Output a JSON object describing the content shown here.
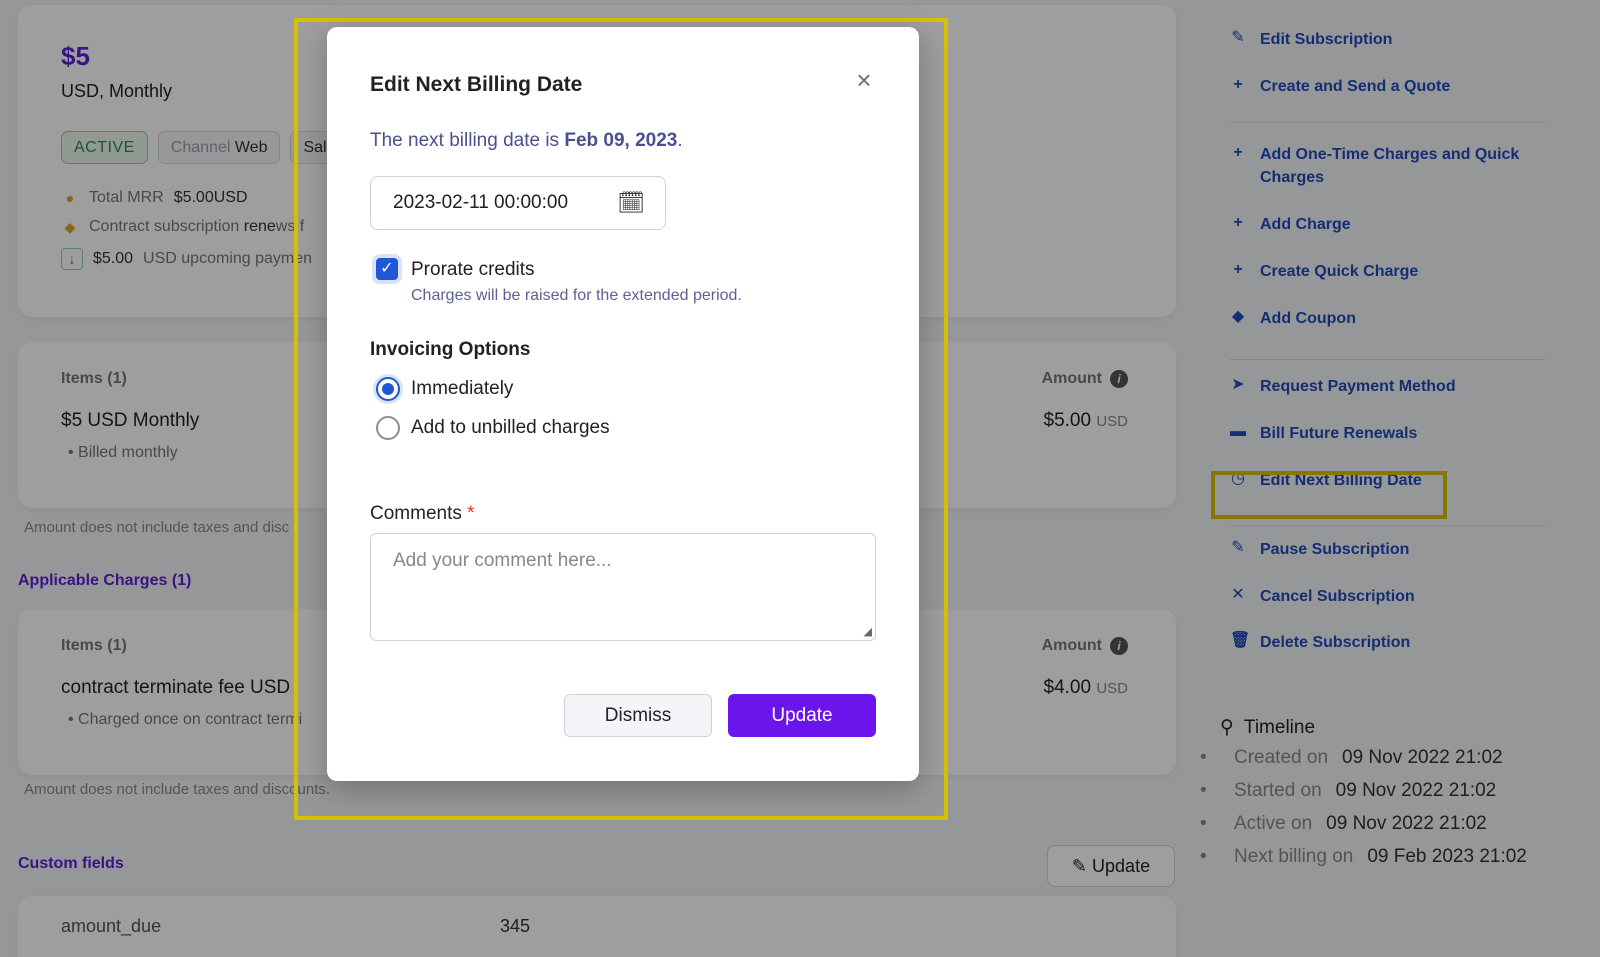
{
  "summary": {
    "price": "$5",
    "price_sub": "USD, Monthly",
    "badge_status": "ACTIVE",
    "badge_channel_label": "Channel",
    "badge_channel_value": "Web",
    "badge_sales_partial": "Sal",
    "total_mrr_label": "Total MRR",
    "total_mrr_value": "$5.00USD",
    "contract_text_a": "Contract subscription",
    "contract_text_b": "rene",
    "contract_text_c": "ws f",
    "upcoming_amount": "$5.00",
    "upcoming_text": "USD upcoming paymen"
  },
  "items": {
    "header": "Items (1)",
    "amount_header": "Amount",
    "name": "$5 USD Monthly",
    "sub": "• Billed monthly",
    "amount": "$5.00",
    "currency": "USD",
    "note": "Amount does not include taxes and disc"
  },
  "charges": {
    "section_title": "Applicable Charges (1)",
    "header": "Items (1)",
    "amount_header": "Amount",
    "name": "contract terminate fee USD",
    "sub": "• Charged once on contract termi",
    "amount": "$4.00",
    "currency": "USD",
    "note": "Amount does not include taxes and discounts."
  },
  "custom_fields": {
    "title": "Custom fields",
    "update_label": "Update",
    "key": "amount_due",
    "value": "345"
  },
  "actions": [
    {
      "label": "Edit Subscription",
      "icon": "pencil-icon",
      "glyph": "✎"
    },
    {
      "label": "Create and Send a Quote",
      "icon": "plus-icon",
      "glyph": "+"
    },
    {
      "label": "Add One-Time Charges and Quick Charges",
      "icon": "plus-icon",
      "glyph": "+"
    },
    {
      "label": "Add Charge",
      "icon": "plus-icon",
      "glyph": "+"
    },
    {
      "label": "Create Quick Charge",
      "icon": "plus-icon",
      "glyph": "+"
    },
    {
      "label": "Add Coupon",
      "icon": "tag-icon",
      "glyph": "◆"
    },
    {
      "label": "Request Payment Method",
      "icon": "send-icon",
      "glyph": "➤"
    },
    {
      "label": "Bill Future Renewals",
      "icon": "card-icon",
      "glyph": "▬"
    },
    {
      "label": "Edit Next Billing Date",
      "icon": "calendar-clock-icon",
      "glyph": "◷"
    },
    {
      "label": "Pause Subscription",
      "icon": "pencil-icon",
      "glyph": "✎"
    },
    {
      "label": "Cancel Subscription",
      "icon": "close-icon",
      "glyph": "✕"
    },
    {
      "label": "Delete Subscription",
      "icon": "trash-icon",
      "glyph": "🗑"
    }
  ],
  "timeline": {
    "title": "Timeline",
    "rows": [
      {
        "label": "Created on",
        "value": "09 Nov 2022 21:02"
      },
      {
        "label": "Started on",
        "value": "09 Nov 2022 21:02"
      },
      {
        "label": "Active on",
        "value": "09 Nov 2022 21:02"
      },
      {
        "label": "Next billing on",
        "value": "09 Feb 2023 21:02"
      }
    ]
  },
  "modal": {
    "title": "Edit Next Billing Date",
    "info_prefix": "The next billing date is",
    "info_date": "Feb 09, 2023",
    "info_suffix": ".",
    "date_value": "2023-02-11 00:00:00",
    "prorate_label": "Prorate credits",
    "prorate_checked": true,
    "prorate_help": "Charges will be raised for the extended period.",
    "invoicing_title": "Invoicing Options",
    "option_immediately": "Immediately",
    "option_unbilled": "Add to unbilled charges",
    "selected_option": "Immediately",
    "comments_label": "Comments",
    "comments_required": "*",
    "comments_placeholder": "Add your comment here...",
    "dismiss_label": "Dismiss",
    "update_label": "Update"
  },
  "colors": {
    "accent": "#6b14ec",
    "link": "#1f4bb8",
    "highlight": "#d8c000"
  }
}
